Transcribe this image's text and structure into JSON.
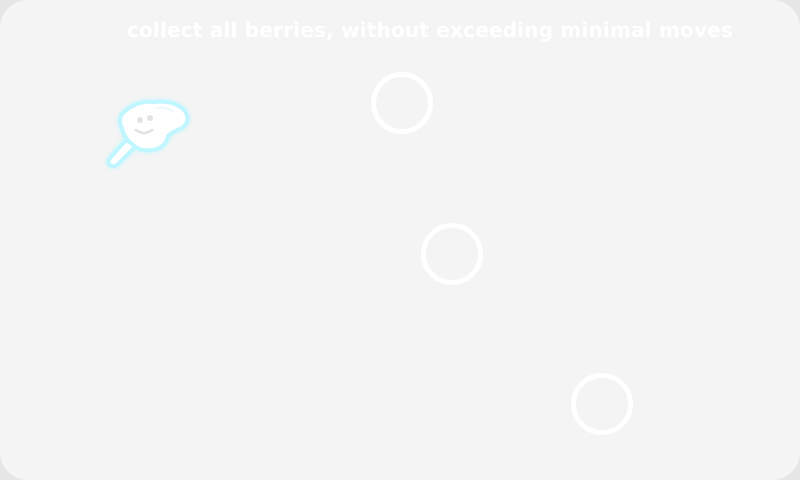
{
  "game": {
    "instruction": "collect all berries, without exceeding minimal moves"
  },
  "player": {
    "icon": "hedgehog-character-icon",
    "glow_color": "#bff6ff"
  },
  "targets": [
    {
      "icon": "empty-berry-slot-icon"
    },
    {
      "icon": "empty-berry-slot-icon"
    },
    {
      "icon": "empty-berry-slot-icon"
    }
  ],
  "colors": {
    "background": "#f4f4f4",
    "text": "#ffffff",
    "slot_ring": "#ffffff"
  }
}
